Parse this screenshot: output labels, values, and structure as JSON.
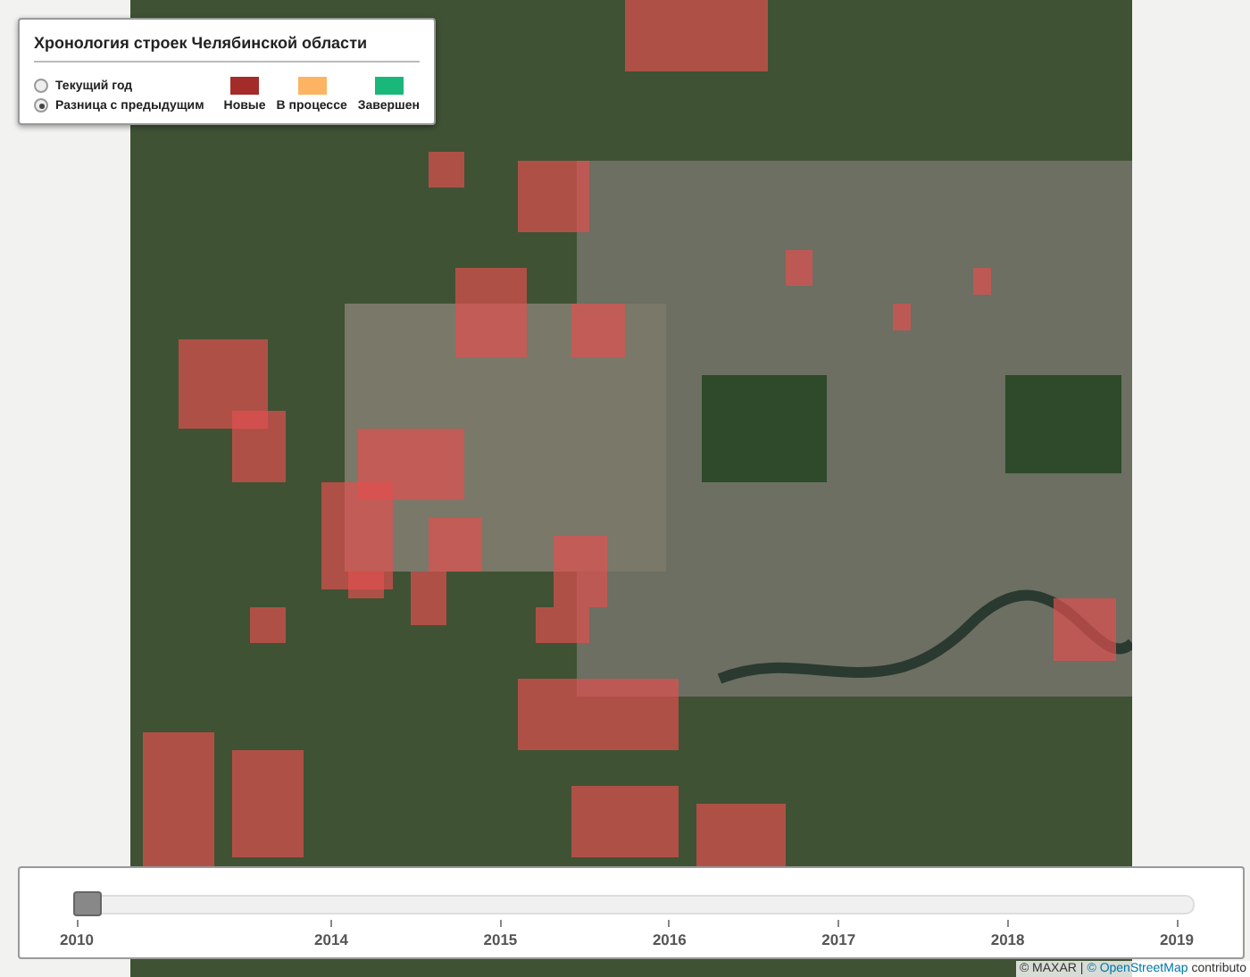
{
  "legend": {
    "title": "Хронология строек Челябинской области",
    "modes": [
      {
        "label": "Текущий год",
        "selected": false
      },
      {
        "label": "Разница с предыдущим",
        "selected": true
      }
    ],
    "categories": [
      {
        "label": "Новые",
        "color": "#a52a2a"
      },
      {
        "label": "В процессе",
        "color": "#fdb462"
      },
      {
        "label": "Завершен",
        "color": "#1ab77a"
      }
    ]
  },
  "timeline": {
    "level": 0,
    "ticks": [
      "2010",
      "2014",
      "2015",
      "2016",
      "2017",
      "2018",
      "2019"
    ]
  },
  "attribution": {
    "provider": "© MAXAR",
    "separator": "|",
    "osm": "© OpenStreetMap",
    "contributors": "contributo"
  }
}
